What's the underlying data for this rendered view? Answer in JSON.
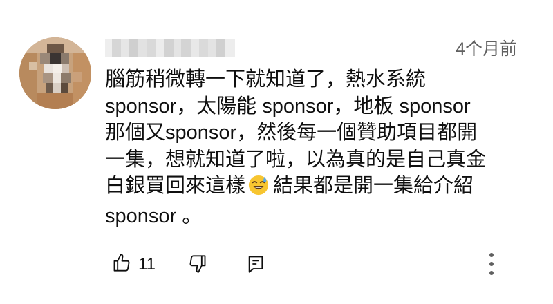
{
  "comment": {
    "author": "",
    "timestamp": "4个月前",
    "lines": [
      "腦筋稍微轉一下就知道了，熱水系統",
      "sponsor，太陽能 sponsor，地板 sponsor",
      "那個又sponsor，然後每一個贊助項目都開",
      "一集，想就知道了啦，以為真的是自己真金",
      "白銀買回來這樣",
      "結果都是開一集給介紹",
      "sponsor 。"
    ],
    "emoji": "sweat-smile-emoji"
  },
  "actions": {
    "like_count": "11",
    "like_icon": "thumbs-up-icon",
    "dislike_icon": "thumbs-down-icon",
    "reply_icon": "reply-icon",
    "more_icon": "more-vertical-icon"
  },
  "colors": {
    "text": "#0f0f0f",
    "secondary_text": "#606060",
    "icon": "#0f0f0f"
  }
}
